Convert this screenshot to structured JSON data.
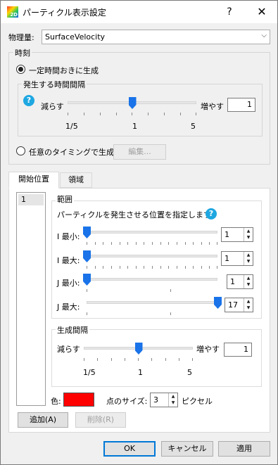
{
  "window": {
    "title": "パーティクル表示設定",
    "help": "?",
    "close": "✕",
    "icon_text": "2D"
  },
  "quantity": {
    "label": "物理量:",
    "value": "SurfaceVelocity"
  },
  "time_group": {
    "label": "時刻",
    "radio_interval": "一定時間おきに生成",
    "interval_group_label": "発生する時間間隔",
    "decrease": "減らす",
    "increase": "増やす",
    "value": "1",
    "ticks": [
      "1/5",
      "1",
      "5"
    ],
    "slider_position": 0.5,
    "radio_arbitrary": "任意のタイミングで生成",
    "edit_button": "編集..."
  },
  "tabs": [
    {
      "label": "開始位置"
    },
    {
      "label": "領域"
    }
  ],
  "list": {
    "items": [
      "1"
    ]
  },
  "range_group": {
    "label": "範囲",
    "description": "パーティクルを発生させる位置を指定します。",
    "rows": [
      {
        "label": "I 最小:",
        "value": "1",
        "position": 0.0
      },
      {
        "label": "I 最大:",
        "value": "1",
        "position": 0.0
      },
      {
        "label": "J 最小:",
        "value": "1",
        "position": 0.0
      },
      {
        "label": "J 最大:",
        "value": "17",
        "position": 1.0
      }
    ]
  },
  "gen_interval_group": {
    "label": "生成間隔",
    "decrease": "減らす",
    "increase": "増やす",
    "value": "1",
    "ticks": [
      "1/5",
      "1",
      "5"
    ],
    "slider_position": 0.5
  },
  "color": {
    "label": "色:",
    "value": "#ff0000"
  },
  "point_size": {
    "label": "点のサイズ:",
    "value": "3",
    "unit": "ピクセル"
  },
  "buttons": {
    "add": "追加(A)",
    "remove": "削除(R)",
    "ok": "OK",
    "cancel": "キャンセル",
    "apply": "適用"
  }
}
